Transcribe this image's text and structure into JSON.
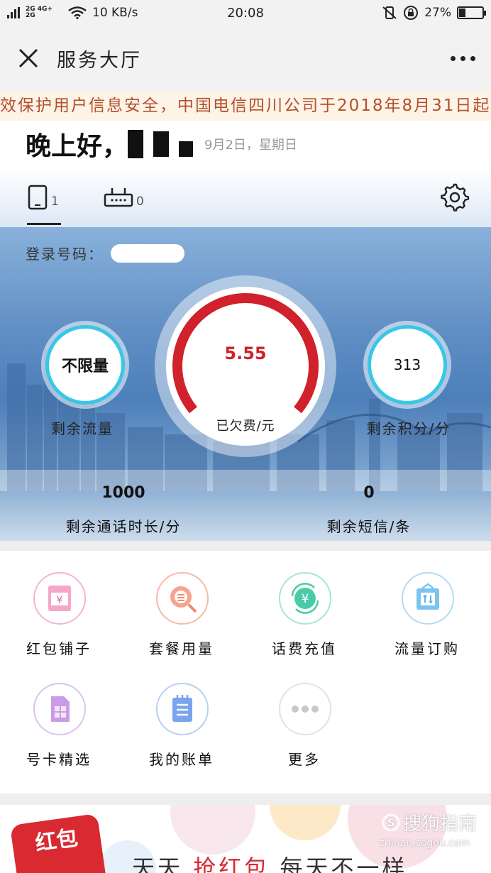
{
  "status_bar": {
    "network_label": "2G 4G+ 2G",
    "speed": "10 KB/s",
    "time": "20:08",
    "battery_percent": 27,
    "battery_label": "27%"
  },
  "nav": {
    "title": "服务大厅"
  },
  "notice": {
    "text": "效保护用户信息安全，中国电信四川公司于2018年8月31日起"
  },
  "greeting": {
    "text": "晚上好，",
    "date": "9月2日，星期日"
  },
  "tabs": [
    {
      "name": "phone",
      "count": "1"
    },
    {
      "name": "broadband",
      "count": "0"
    }
  ],
  "account": {
    "login_label": "登录号码："
  },
  "stats": {
    "data_value": "不限量",
    "data_label": "剩余流量",
    "balance_value": "5.55",
    "balance_label": "已欠费/元",
    "points_value": "313",
    "points_label": "剩余积分/分",
    "call_value": "1000",
    "call_label": "剩余通话时长/分",
    "sms_value": "0",
    "sms_label": "剩余短信/条"
  },
  "menu": [
    {
      "label": "红包铺子",
      "icon": "red-envelope-icon",
      "color": "#e97db0"
    },
    {
      "label": "套餐用量",
      "icon": "package-search-icon",
      "color": "#f08a6e"
    },
    {
      "label": "话费充值",
      "icon": "recharge-yuan-icon",
      "color": "#3ec6a3"
    },
    {
      "label": "流量订购",
      "icon": "data-order-icon",
      "color": "#5bb4e8"
    },
    {
      "label": "号卡精选",
      "icon": "sim-card-icon",
      "color": "#b57ee0"
    },
    {
      "label": "我的账单",
      "icon": "bill-icon",
      "color": "#6a9ae6"
    },
    {
      "label": "更多",
      "icon": "more-dots-icon",
      "color": "#c8c8c8"
    }
  ],
  "banner": {
    "badge": "红包",
    "text_a": "天天",
    "text_b": "抢红包",
    "text_c": "每天不一样"
  },
  "watermark": {
    "text": "搜狗指南",
    "sub": "zhinan.sogou.com"
  },
  "colors": {
    "accent_red": "#d0212c",
    "ring_cyan": "#38c7e6",
    "notice_text": "#b3502c",
    "notice_bg": "#fdf3e7"
  }
}
